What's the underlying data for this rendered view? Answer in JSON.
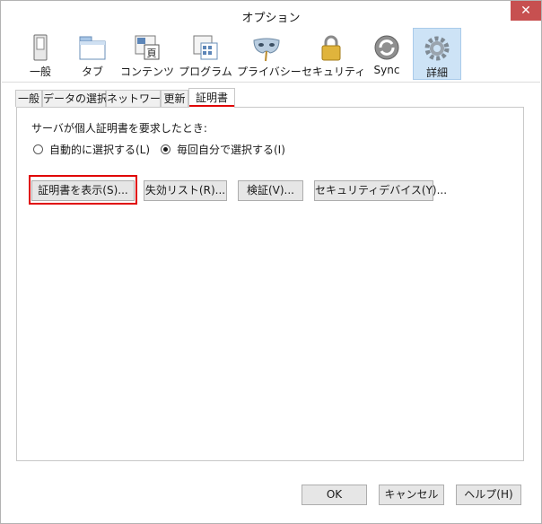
{
  "window": {
    "title": "オプション",
    "close_glyph": "✕"
  },
  "toolbar": {
    "items": [
      {
        "label": "一般",
        "icon": "switch-icon"
      },
      {
        "label": "タブ",
        "icon": "tabs-window-icon"
      },
      {
        "label": "コンテンツ",
        "icon": "content-icon"
      },
      {
        "label": "プログラム",
        "icon": "applications-icon"
      },
      {
        "label": "プライバシー",
        "icon": "mask-icon"
      },
      {
        "label": "セキュリティ",
        "icon": "padlock-icon"
      },
      {
        "label": "Sync",
        "icon": "sync-icon"
      },
      {
        "label": "詳細",
        "icon": "gear-icon",
        "selected": true
      }
    ]
  },
  "tabs": [
    {
      "label": "一般"
    },
    {
      "label": "データの選択"
    },
    {
      "label": "ネットワーク"
    },
    {
      "label": "更新"
    },
    {
      "label": "証明書",
      "active": true
    }
  ],
  "certificates": {
    "prompt": "サーバが個人証明書を要求したとき:",
    "option_auto": "自動的に選択する(L)",
    "option_manual": "毎回自分で選択する(I)",
    "selected_option": "option_manual",
    "buttons": {
      "view": "証明書を表示(S)...",
      "revocation": "失効リスト(R)...",
      "validation": "検証(V)...",
      "devices": "セキュリティデバイス(Y)..."
    }
  },
  "footer": {
    "ok": "OK",
    "cancel": "キャンセル",
    "help": "ヘルプ(H)"
  },
  "colors": {
    "highlight": "#e00000",
    "selected_bg": "#cde3f6",
    "close_bg": "#c75050"
  }
}
